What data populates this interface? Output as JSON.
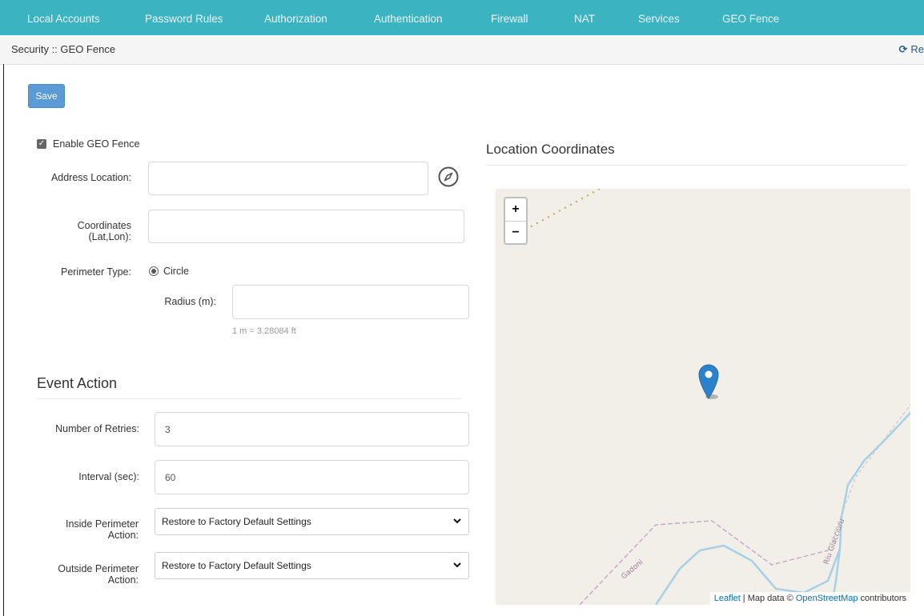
{
  "nav": {
    "items": [
      "Local Accounts",
      "Password Rules",
      "Authorization",
      "Authentication",
      "Firewall",
      "NAT",
      "Services",
      "GEO Fence"
    ]
  },
  "breadcrumb": "Security :: GEO Fence",
  "refresh_label": "Re",
  "save_label": "Save",
  "geo": {
    "enable_label": "Enable GEO Fence",
    "address_label": "Address Location:",
    "address_value": "",
    "coords_label_line1": "Coordinates",
    "coords_label_line2": "(Lat,Lon):",
    "coords_value": "",
    "perimeter_label": "Perimeter Type:",
    "perimeter_option": "Circle",
    "radius_label": "Radius (m):",
    "radius_value": "",
    "radius_hint": "1 m = 3.28084 ft"
  },
  "event": {
    "title": "Event Action",
    "retries_label": "Number of Retries:",
    "retries_value": "3",
    "interval_label": "Interval (sec):",
    "interval_value": "60",
    "inside_label_line1": "Inside Perimeter",
    "inside_label_line2": "Action:",
    "inside_value": "Restore to Factory Default Settings",
    "outside_label_line1": "Outside Perimeter",
    "outside_label_line2": "Action:",
    "outside_value": "Restore to Factory Default Settings"
  },
  "map": {
    "title": "Location Coordinates",
    "zoom_in": "+",
    "zoom_out": "−",
    "street_label_1": "Gadoni",
    "street_label_2": "Riu Giacciuru",
    "attribution_leaflet": "Leaflet",
    "attribution_mid": " | Map data © ",
    "attribution_osm": "OpenStreetMap",
    "attribution_end": " contributors"
  },
  "colors": {
    "nav_bg": "#3cb3c0",
    "save_btn": "#5b9bd5",
    "map_bg": "#f2efe9",
    "river": "#a7d0e6",
    "marker": "#2b82cb"
  }
}
